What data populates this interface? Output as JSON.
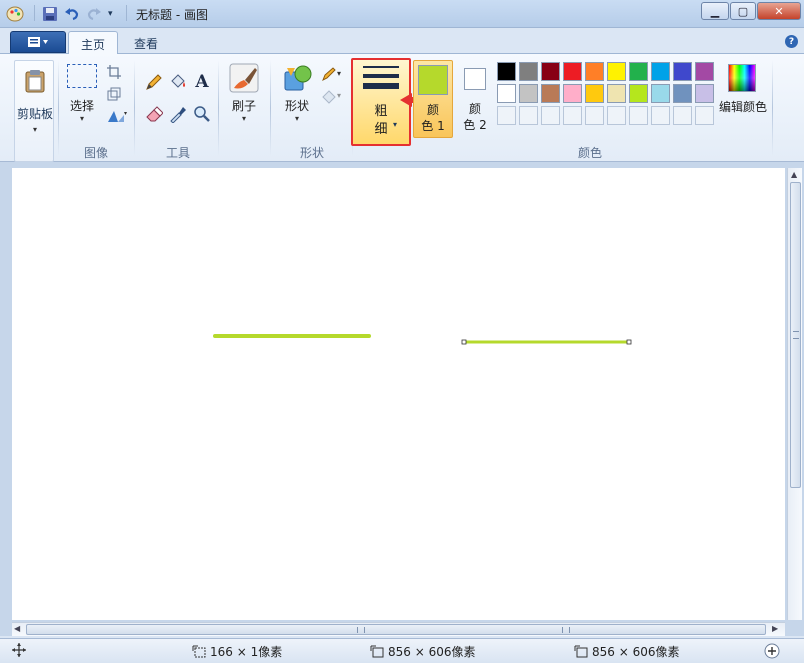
{
  "window": {
    "title": "无标题 - 画图"
  },
  "tabs": [
    {
      "label": "主页",
      "active": true
    },
    {
      "label": "查看",
      "active": false
    }
  ],
  "ribbon": {
    "clipboard": {
      "paste_label": "剪贴板"
    },
    "image": {
      "group_label": "图像",
      "select_label": "选择"
    },
    "tools": {
      "group_label": "工具"
    },
    "brushes": {
      "label": "刷子"
    },
    "shapes": {
      "group_label": "形状",
      "shapes_label": "形状"
    },
    "size": {
      "label_line1": "粗",
      "label_line2": "细"
    },
    "colors": {
      "group_label": "颜色",
      "color1_line1": "颜",
      "color1_line2": "色 1",
      "color2_line1": "颜",
      "color2_line2": "色 2",
      "edit_label": "编辑颜色",
      "color1_value": "#b5d92c",
      "color2_value": "#ffffff",
      "palette_row1": [
        "#000000",
        "#7f7f7f",
        "#880015",
        "#ed1c24",
        "#ff7f27",
        "#fff200",
        "#22b14c",
        "#00a2e8",
        "#3f48cc",
        "#a349a4"
      ],
      "palette_row2": [
        "#ffffff",
        "#c3c3c3",
        "#b97a57",
        "#ffaec9",
        "#ffc90e",
        "#efe4b0",
        "#b5e61d",
        "#99d9ea",
        "#7092be",
        "#c8bfe7"
      ]
    }
  },
  "canvas": {
    "stroke_color": "#b5d92c"
  },
  "status": {
    "selection_size": "166 × 1像素",
    "canvas_size_1": "856 × 606像素",
    "canvas_size_2": "856 × 606像素"
  }
}
